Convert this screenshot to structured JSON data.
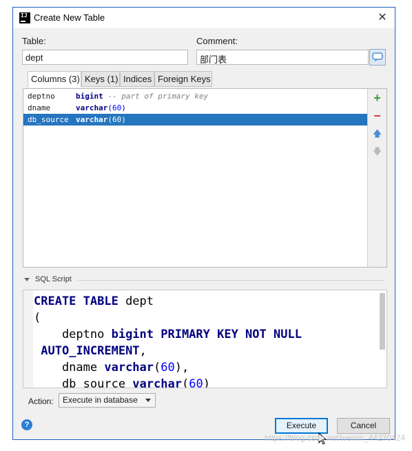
{
  "window": {
    "title": "Create New Table"
  },
  "form": {
    "table_label": "Table:",
    "table_value": "dept",
    "comment_label": "Comment:",
    "comment_value": "部门表"
  },
  "tabs": [
    {
      "label": "Columns (3)",
      "active": true
    },
    {
      "label": "Keys (1)",
      "active": false
    },
    {
      "label": "Indices",
      "active": false
    },
    {
      "label": "Foreign Keys",
      "active": false
    }
  ],
  "columns": [
    {
      "name": "deptno",
      "type": "bigint",
      "size": "",
      "comment": "-- part of primary key",
      "selected": false
    },
    {
      "name": "dname",
      "type": "varchar",
      "size": "60",
      "comment": "",
      "selected": false
    },
    {
      "name": "db_source",
      "type": "varchar",
      "size": "60",
      "comment": "",
      "selected": true
    }
  ],
  "toolbar": {
    "add": "+",
    "remove": "−",
    "move_up": "🡅",
    "move_down": "🡇"
  },
  "sql": {
    "header": "SQL Script",
    "lines": [
      "CREATE TABLE dept",
      "(",
      "    deptno bigint PRIMARY KEY NOT NULL",
      " AUTO_INCREMENT,",
      "    dname varchar(60),",
      "    db_source varchar(60)"
    ]
  },
  "action": {
    "label": "Action:",
    "selected": "Execute in database"
  },
  "buttons": {
    "help": "?",
    "execute": "Execute",
    "cancel": "Cancel"
  },
  "watermark": "https://blog.csdn.net/weixin_44270424",
  "colors": {
    "selection": "#2675bf",
    "add_icon": "#3a9b3a",
    "remove_icon": "#d04343",
    "arrow_icon": "#4a8fd0",
    "keyword": "#000080",
    "number": "#0000ff"
  }
}
